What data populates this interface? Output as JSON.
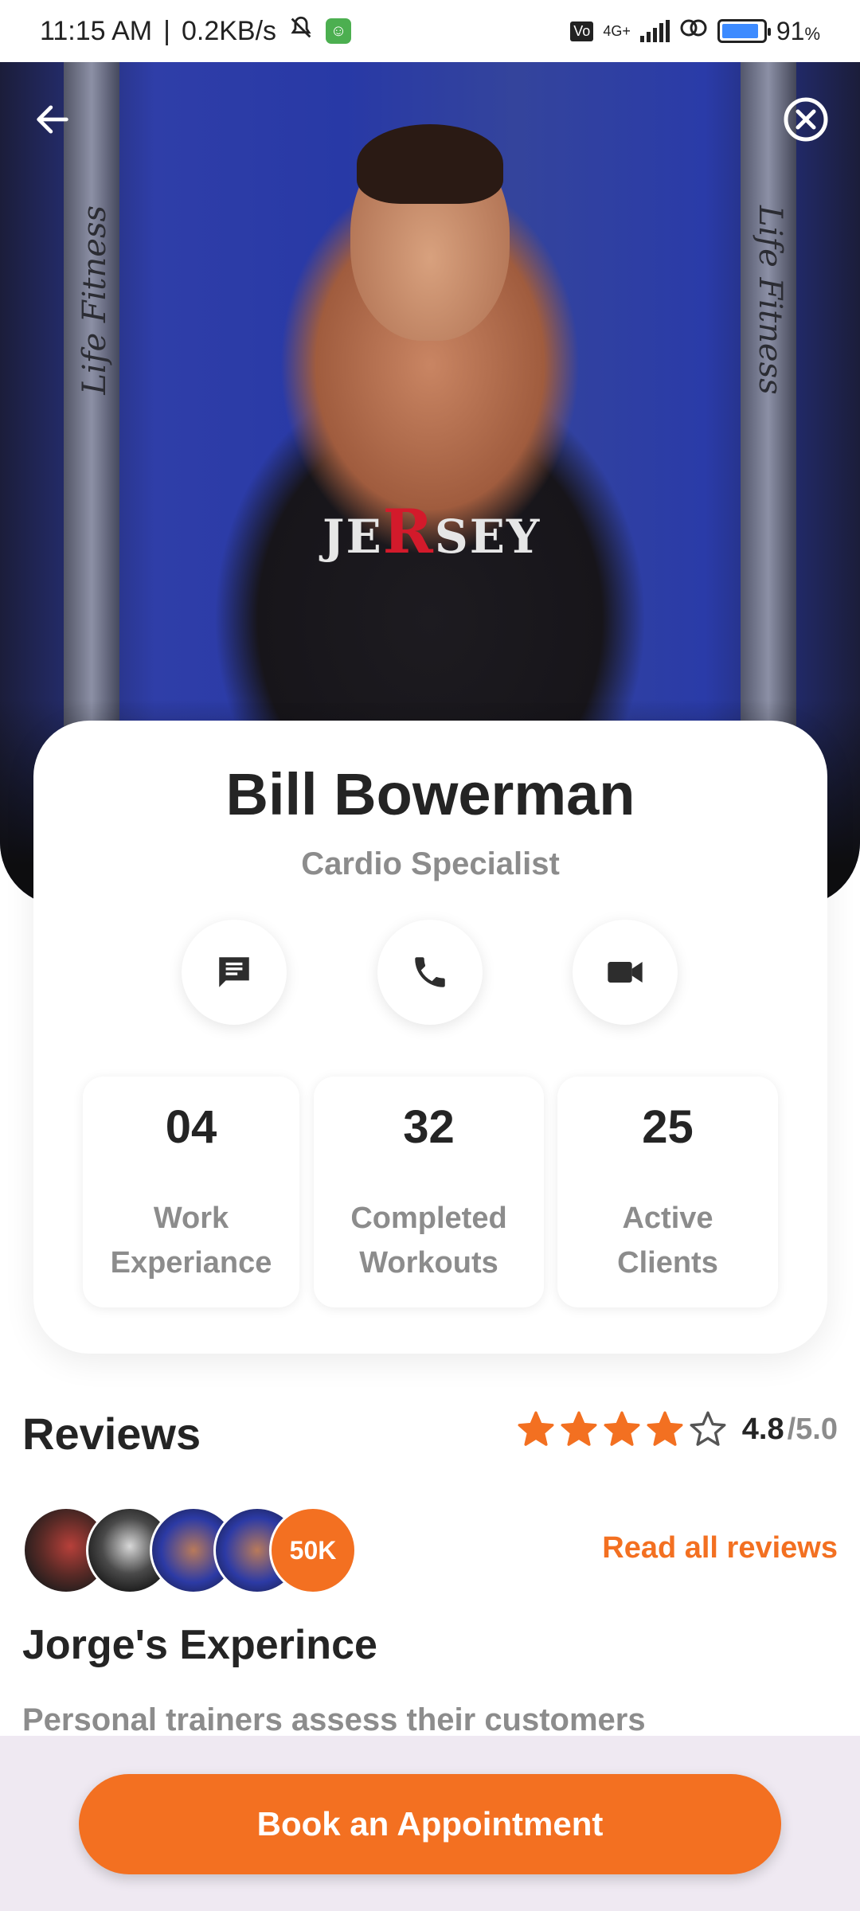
{
  "status_bar": {
    "time": "11:15 AM",
    "speed": "0.2KB/s",
    "network": "4G+",
    "battery": "91",
    "battery_unit": "%",
    "battery_level": 0.91
  },
  "header": {
    "back_icon": "arrow-left-icon",
    "close_icon": "close-circle-icon"
  },
  "trainer": {
    "name": "Bill Bowerman",
    "role": "Cardio Specialist",
    "shirt_text_left": "JE",
    "shirt_text_mid": "R",
    "shirt_text_right": "SEY",
    "gym_brand": "Life Fitness"
  },
  "actions": [
    {
      "icon": "message-icon"
    },
    {
      "icon": "phone-icon"
    },
    {
      "icon": "video-camera-icon"
    }
  ],
  "stats": [
    {
      "value": "04",
      "label": "Work\nExperiance"
    },
    {
      "value": "32",
      "label": "Completed\nWorkouts"
    },
    {
      "value": "25",
      "label": "Active\nClients"
    }
  ],
  "reviews": {
    "title": "Reviews",
    "rating": "4.8",
    "rating_max": "/5.0",
    "stars_filled": 4,
    "stars_total": 5,
    "review_count": "50K",
    "read_all_label": "Read all reviews",
    "review_title": "Jorge's Experince",
    "review_text": "Personal trainers assess their customers"
  },
  "footer": {
    "book_label": "Book an Appointment"
  },
  "colors": {
    "accent": "#f37021",
    "text_primary": "#242424",
    "text_secondary": "#8c8c8c",
    "footer_bg": "#efe9f2"
  }
}
